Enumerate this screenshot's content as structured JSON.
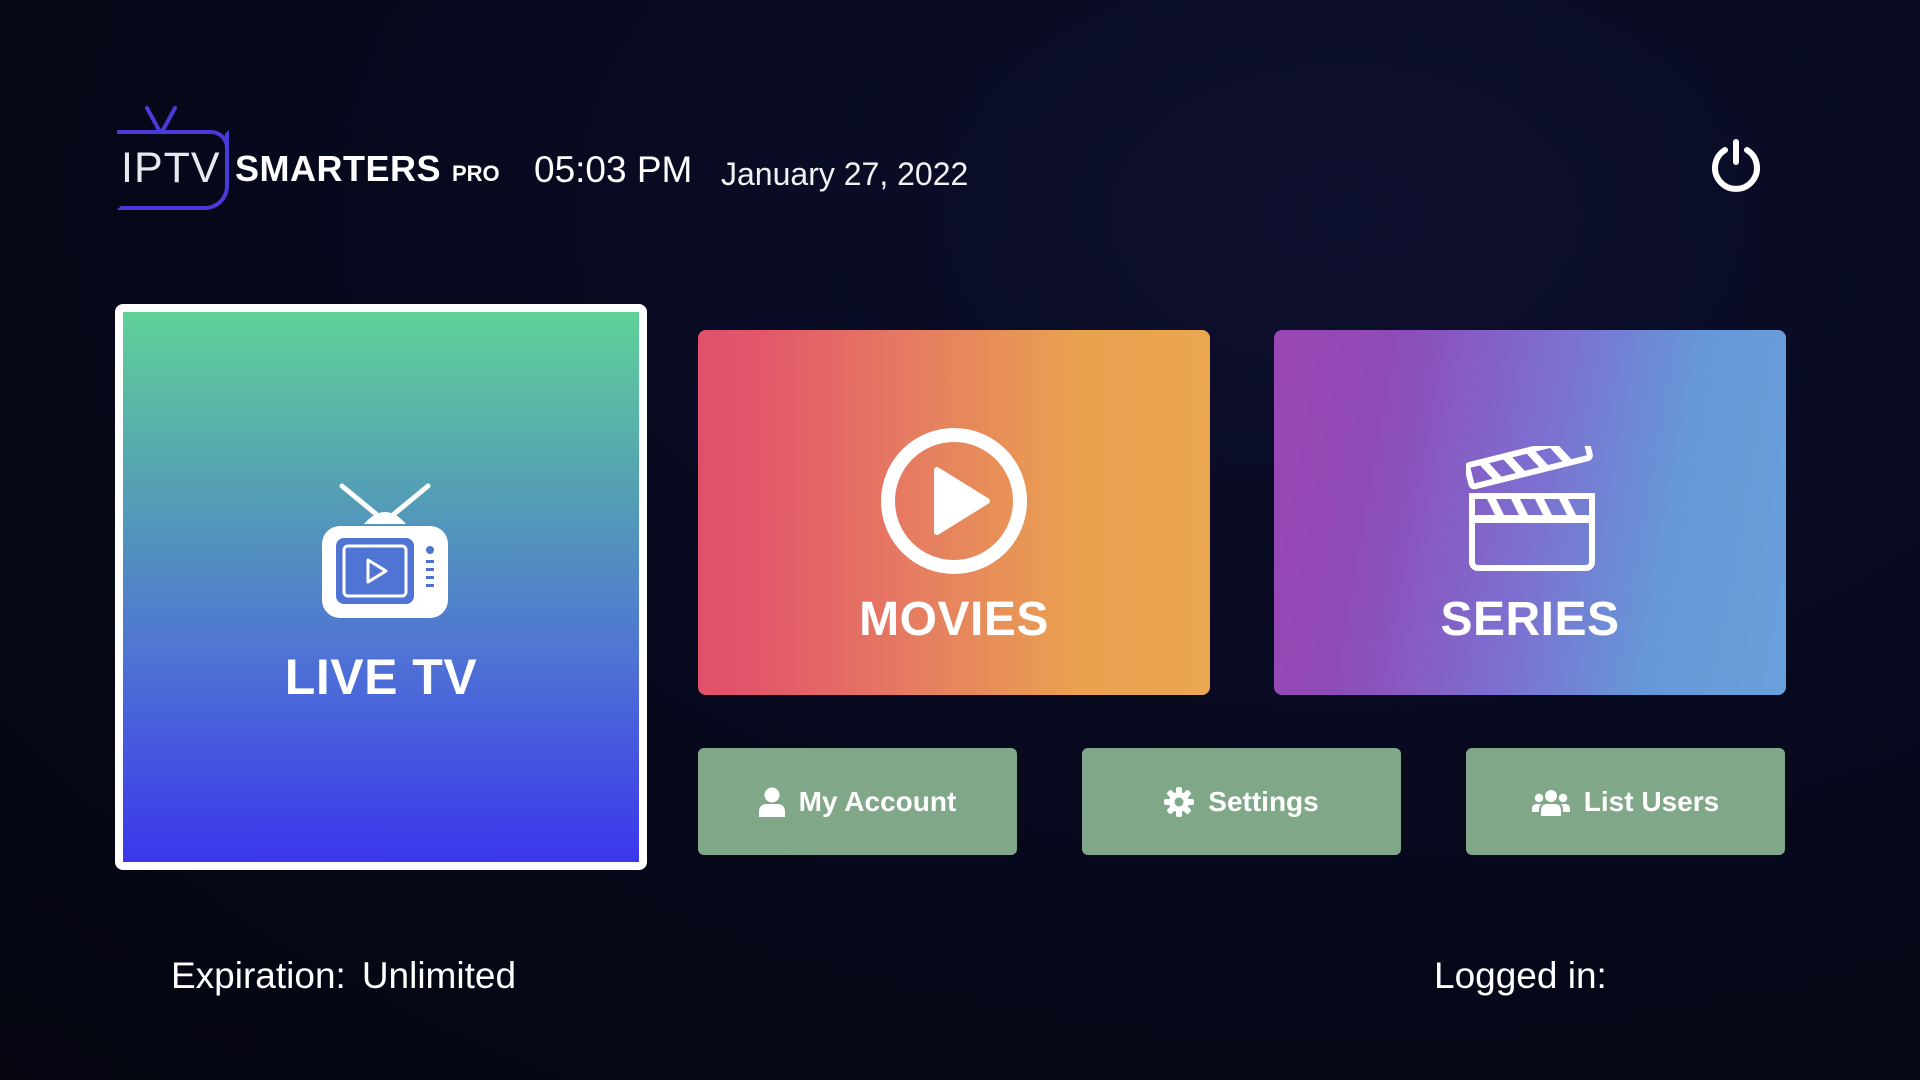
{
  "header": {
    "logo": {
      "part1": "IPTV",
      "part2": "SMARTERS",
      "part3": "PRO"
    },
    "time": "05:03 PM",
    "date": "January 27, 2022",
    "power_icon": "power-icon"
  },
  "tiles": {
    "live_tv": {
      "label": "LIVE TV",
      "icon": "tv-icon"
    },
    "movies": {
      "label": "MOVIES",
      "icon": "play-circle-icon"
    },
    "series": {
      "label": "SERIES",
      "icon": "clapperboard-icon"
    }
  },
  "actions": {
    "my_account": {
      "label": "My Account",
      "icon": "user-icon"
    },
    "settings": {
      "label": "Settings",
      "icon": "gear-icon"
    },
    "list_users": {
      "label": "List Users",
      "icon": "users-icon"
    }
  },
  "footer": {
    "expiration_label": "Expiration:",
    "expiration_value": "Unlimited",
    "logged_in_label": "Logged in:"
  },
  "colors": {
    "background": "#070a1f",
    "live_tv_top": "#60d199",
    "live_tv_bottom": "#3b36ec",
    "movies_left": "#e0506a",
    "movies_right": "#eba651",
    "series_left": "#9a47b4",
    "series_right": "#6aa0db",
    "action_button": "#80a888",
    "logo_accent": "#4a3bd8"
  }
}
